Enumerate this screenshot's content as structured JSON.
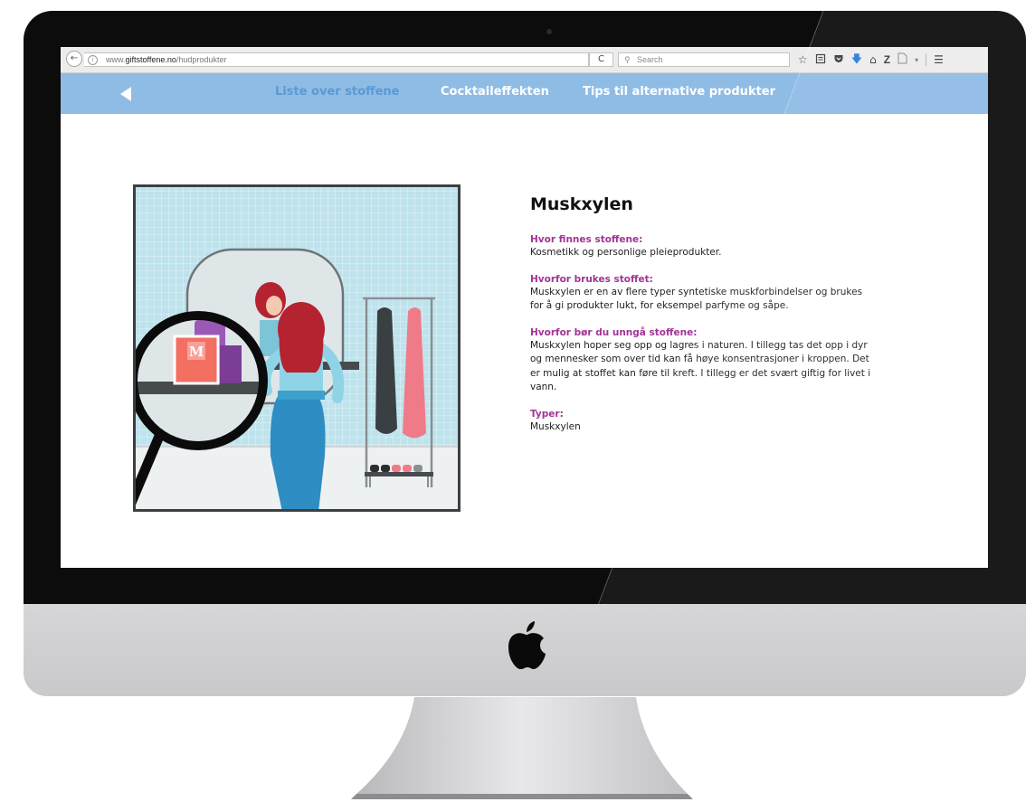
{
  "browser": {
    "url_prefix": "www.",
    "url_domain": "giftstoffene.no",
    "url_path": "/hudprodukter",
    "search_placeholder": "Search",
    "reload_symbol": "C"
  },
  "nav": {
    "items": [
      {
        "label": "Liste over stoffene",
        "active": true
      },
      {
        "label": "Cocktaileffekten",
        "active": false
      },
      {
        "label": "Tips til alternative produkter",
        "active": false
      }
    ]
  },
  "product_label": "M",
  "article": {
    "title": "Muskxylen",
    "sections": [
      {
        "heading": "Hvor finnes stoffene:",
        "text": "Kosmetikk og personlige pleieprodukter."
      },
      {
        "heading": "Hvorfor brukes stoffet:",
        "text": "Muskxylen er en av flere typer syntetiske muskforbindelser og brukes for å gi produkter lukt, for eksempel parfyme og såpe."
      },
      {
        "heading": "Hvorfor bør du unngå stoffene:",
        "text": "Muskxylen hoper seg opp og lagres i naturen. I tillegg tas det opp i dyr og mennesker som over tid kan få høye konsentrasjoner i kropp­en. Det er mulig at stoffet kan føre til kreft. I tillegg er det svært giftig for livet i vann."
      },
      {
        "heading": "Typer:",
        "text": "Muskxylen"
      }
    ]
  },
  "colors": {
    "nav_bar": "#8fbce5",
    "nav_active": "#5a9ad4",
    "heading_accent": "#a33396",
    "tile_wall": "#bfe3ec"
  },
  "icons": [
    "back-arrow-icon",
    "info-icon",
    "reload-icon",
    "search-icon",
    "bookmark-star-icon",
    "reading-list-icon",
    "pocket-icon",
    "download-icon",
    "home-icon",
    "zotero-icon",
    "page-icon",
    "menu-icon",
    "apple-logo-icon",
    "magnifier-icon"
  ]
}
